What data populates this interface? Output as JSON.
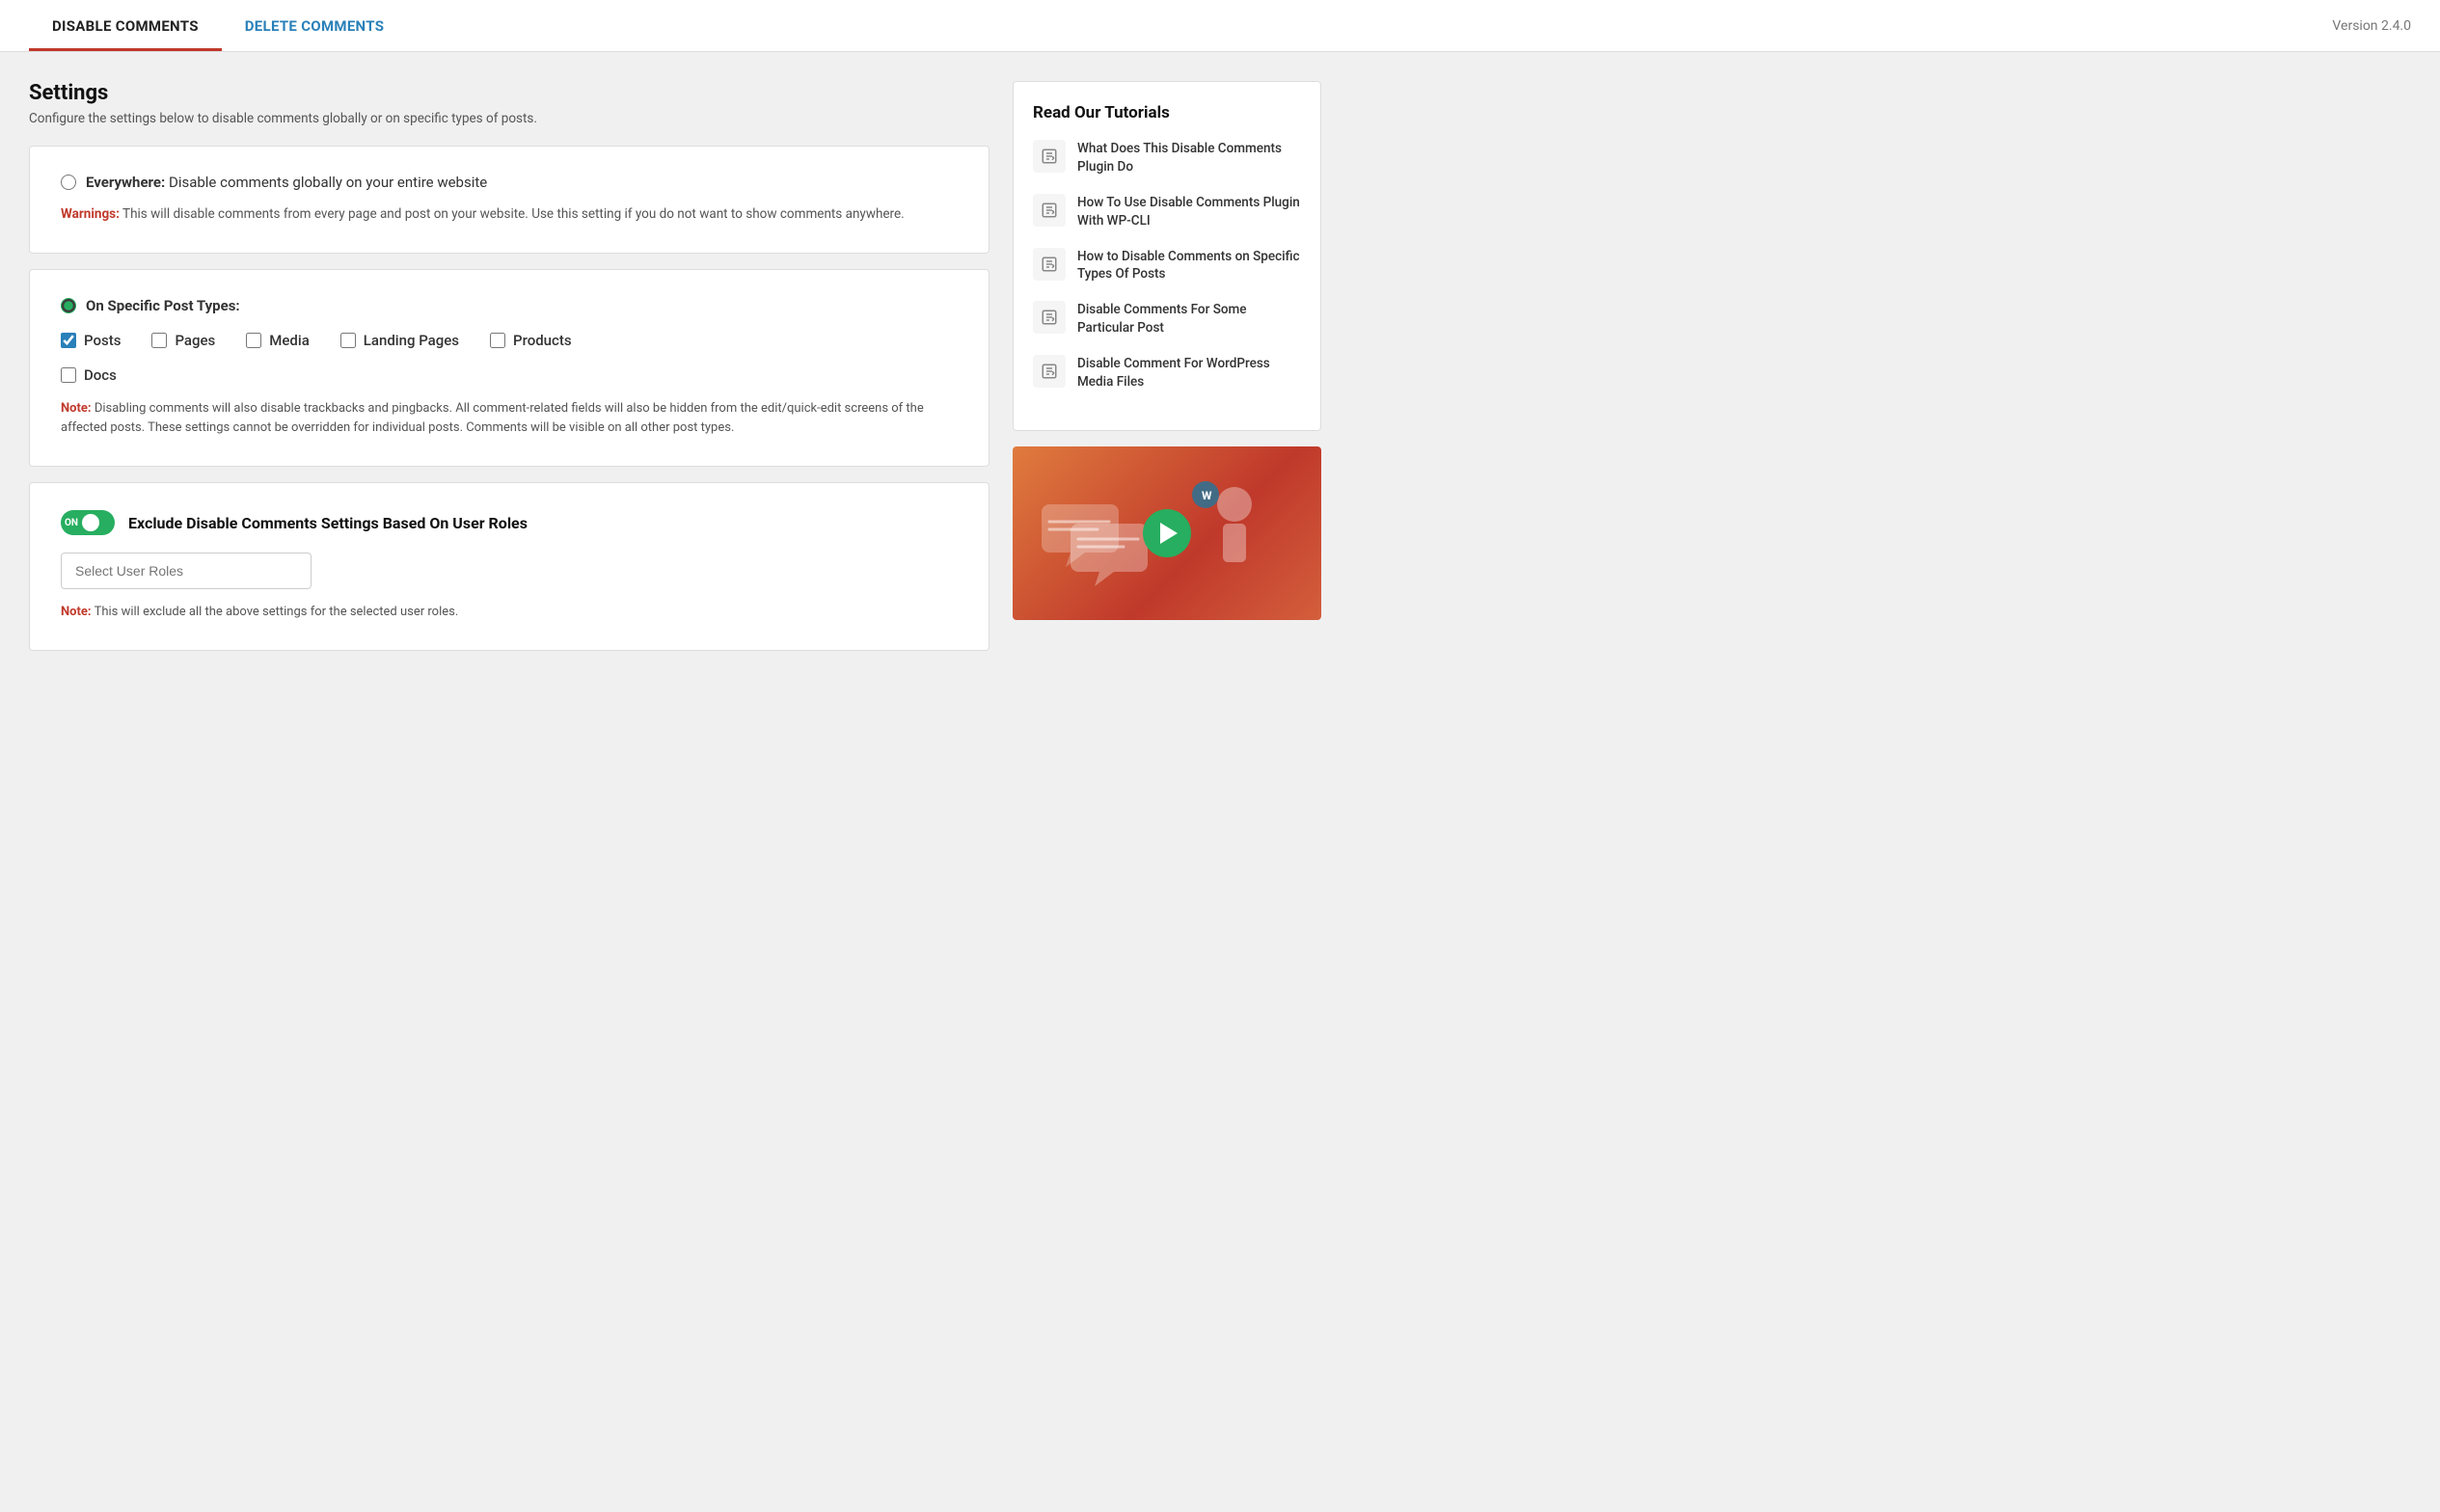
{
  "nav": {
    "tab_disable": "DISABLE COMMENTS",
    "tab_delete": "DELETE COMMENTS",
    "version": "Version 2.4.0"
  },
  "settings": {
    "title": "Settings",
    "subtitle": "Configure the settings below to disable comments globally or on specific types of posts.",
    "everywhere_label": "Everywhere:",
    "everywhere_desc": "Disable comments globally on your entire website",
    "warning_label": "Warnings:",
    "warning_text": "This will disable comments from every page and post on your website. Use this setting if you do not want to show comments anywhere.",
    "specific_label": "On Specific Post Types:",
    "post_types": [
      "Posts",
      "Pages",
      "Media",
      "Landing Pages",
      "Products",
      "Docs"
    ],
    "post_types_checked": [
      true,
      false,
      false,
      false,
      false,
      false
    ],
    "note_label": "Note:",
    "note_text": "Disabling comments will also disable trackbacks and pingbacks. All comment-related fields will also be hidden from the edit/quick-edit screens of the affected posts. These settings cannot be overridden for individual posts. Comments will be visible on all other post types.",
    "exclude_toggle_label": "ON",
    "exclude_title": "Exclude Disable Comments Settings Based On User Roles",
    "select_placeholder": "Select User Roles",
    "exclude_note_label": "Note:",
    "exclude_note_text": "This will exclude all the above settings for the selected user roles."
  },
  "sidebar": {
    "tutorials_title": "Read Our Tutorials",
    "tutorials": [
      "What Does This Disable Comments Plugin Do",
      "How To Use Disable Comments Plugin With WP-CLI",
      "How to Disable Comments on Specific Types Of Posts",
      "Disable Comments For Some Particular Post",
      "Disable Comment For WordPress Media Files"
    ]
  }
}
